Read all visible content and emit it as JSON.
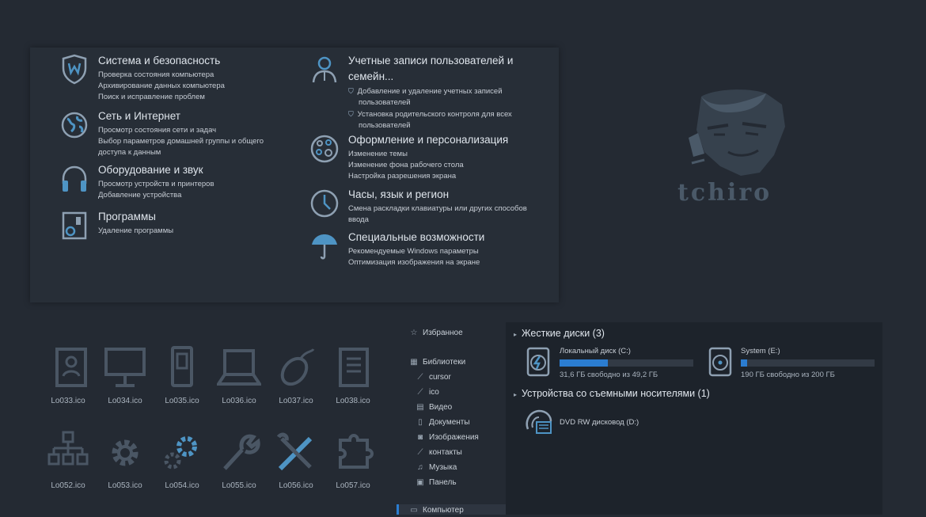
{
  "control_panel": {
    "categories": [
      {
        "title": "Система и безопасность",
        "links": [
          "Проверка состояния компьютера",
          "Архивирование данных компьютера",
          "Поиск и исправление проблем"
        ]
      },
      {
        "title": "Сеть и Интернет",
        "links": [
          "Просмотр состояния сети и задач",
          "Выбор параметров домашней группы и общего",
          "доступа к данным"
        ]
      },
      {
        "title": "Оборудование и звук",
        "links": [
          "Просмотр устройств и принтеров",
          "Добавление устройства"
        ]
      },
      {
        "title": "Программы",
        "links": [
          "Удаление программы"
        ]
      },
      {
        "title_line1": "Учетные записи пользователей и",
        "title_line2": "семейн...",
        "links": [
          "Добавление и удаление учетных записей",
          "пользователей",
          "Установка родительского контроля для всех",
          "пользователей"
        ]
      },
      {
        "title": "Оформление и персонализация",
        "links": [
          "Изменение темы",
          "Изменение фона рабочего стола",
          "Настройка разрешения экрана"
        ]
      },
      {
        "title": "Часы, язык и регион",
        "links": [
          "Смена раскладки клавиатуры или других способов",
          "ввода"
        ]
      },
      {
        "title": "Специальные возможности",
        "links": [
          "Рекомендуемые Windows параметры",
          "Оптимизация изображения на экране"
        ]
      }
    ]
  },
  "logo": {
    "text": "tchiro"
  },
  "icon_grid": {
    "row1": [
      "Lo033.ico",
      "Lo034.ico",
      "Lo035.ico",
      "Lo036.ico",
      "Lo037.ico",
      "Lo038.ico"
    ],
    "row2": [
      "Lo052.ico",
      "Lo053.ico",
      "Lo054.ico",
      "Lo055.ico",
      "Lo056.ico",
      "Lo057.ico"
    ]
  },
  "explorer": {
    "nav": {
      "favorites": "Избранное",
      "libraries": "Библиотеки",
      "library_items": [
        "cursor",
        "ico",
        "Видео",
        "Документы",
        "Изображения",
        "контакты",
        "Музыка",
        "Панель"
      ],
      "computer": "Компьютер"
    },
    "hdd_section": "Жесткие диски (3)",
    "removable_section": "Устройства со съемными носителями (1)",
    "drives": [
      {
        "name": "Локальный диск (C:)",
        "free": "31,6 ГБ свободно из 49,2 ГБ",
        "used_fraction": 0.36
      },
      {
        "name": "System (E:)",
        "free": "190 ГБ свободно из 200 ГБ",
        "used_fraction": 0.05
      }
    ],
    "dvd": "DVD RW дисковод (D:)"
  },
  "colors": {
    "accent": "#2b7dd1",
    "icon_blue": "#4e94c4",
    "background": "#242a33"
  }
}
